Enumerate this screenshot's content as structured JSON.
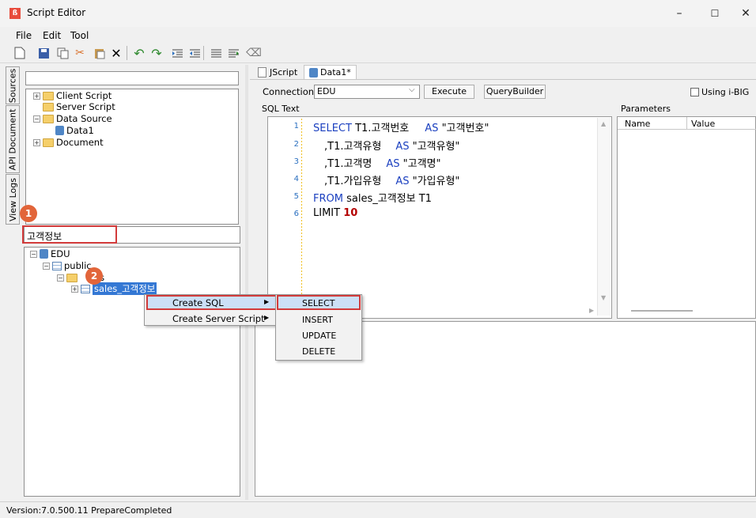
{
  "window": {
    "title": "Script Editor",
    "minimize": "–",
    "maximize": "☐",
    "close": "✕"
  },
  "menu": [
    "File",
    "Edit",
    "Tool"
  ],
  "side_tabs": [
    "Sources",
    "API Document",
    "View Logs"
  ],
  "script_tree": {
    "items": [
      {
        "label": "Client Script",
        "expand": "+"
      },
      {
        "label": "Server Script"
      },
      {
        "label": "Data Source",
        "expand": "−"
      },
      {
        "label": "Data1"
      },
      {
        "label": "Document",
        "expand": "+"
      }
    ]
  },
  "db_search": {
    "value": "고객정보"
  },
  "db_tree": {
    "root": "EDU",
    "schema": "public",
    "tables_folder": "es",
    "table": "sales_고객정보"
  },
  "badges": {
    "one": "1",
    "two": "2"
  },
  "tabs": {
    "jscript": "JScript",
    "data1": "Data1*"
  },
  "connection": {
    "label": "Connection",
    "value": "EDU"
  },
  "buttons": {
    "execute": "Execute",
    "querybuilder": "QueryBuilder"
  },
  "using_ibig": "Using i-BIG",
  "sql_text_label": "SQL Text",
  "parameters": {
    "label": "Parameters",
    "col_name": "Name",
    "col_value": "Value"
  },
  "sql_lines": [
    {
      "n": "1",
      "kw1": "SELECT",
      "t1": " T1.고객번호",
      "kw2": "AS",
      "t2": " \"고객번호\""
    },
    {
      "n": "2",
      "kw1": "",
      "t1": ",T1.고객유형",
      "kw2": "AS",
      "t2": " \"고객유형\""
    },
    {
      "n": "3",
      "kw1": "",
      "t1": ",T1.고객명",
      "kw2": "AS",
      "t2": " \"고객명\""
    },
    {
      "n": "4",
      "kw1": "",
      "t1": ",T1.가입유형",
      "kw2": "AS",
      "t2": " \"가입유형\""
    },
    {
      "n": "5",
      "kw1": "FROM",
      "t1": " sales_고객정보 T1",
      "kw2": "",
      "t2": ""
    },
    {
      "n": "6",
      "kw1": "LIMIT",
      "t1": "",
      "kw2": "",
      "t2": "10"
    }
  ],
  "context_menu": {
    "items": [
      "Create SQL",
      "Create Server Script"
    ],
    "submenu": [
      "SELECT",
      "INSERT",
      "UPDATE",
      "DELETE"
    ]
  },
  "status": "Version:7.0.500.11  PrepareCompleted"
}
